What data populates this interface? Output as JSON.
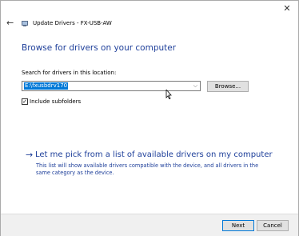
{
  "window": {
    "title": "Update Drivers - FX-USB-AW",
    "close_glyph": "✕",
    "back_glyph": "←"
  },
  "heading": "Browse for drivers on your computer",
  "search": {
    "label": "Search for drivers in this location:",
    "value": "E:\\fxusbdrv170",
    "dropdown_glyph": "⌵",
    "browse_label": "Browse..."
  },
  "include_subfolders": {
    "label": "Include subfolders",
    "checked": true,
    "check_glyph": "✓"
  },
  "pick_link": {
    "arrow": "→",
    "text": "Let me pick from a list of available drivers on my computer",
    "description": "This list will show available drivers compatible with the device, and all drivers in the same category as the device."
  },
  "footer": {
    "next_label": "Next",
    "cancel_label": "Cancel"
  },
  "colors": {
    "link_blue": "#1e3f9a",
    "selection_blue": "#0078d7"
  }
}
